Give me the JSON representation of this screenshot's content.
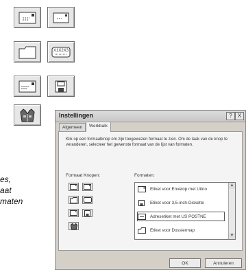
{
  "side_text": {
    "line1": "es,",
    "line2": "aat",
    "line3": "maten"
  },
  "toolbar_large": {
    "buttons": [
      {
        "icon": "envelope-icon"
      },
      {
        "icon": "envelope-small-icon"
      },
      {
        "icon": "folder-label-icon"
      },
      {
        "icon": "address-label-icon"
      },
      {
        "icon": "envelope-wide-icon"
      },
      {
        "icon": "floppy-label-icon"
      },
      {
        "icon": "vest-icon"
      }
    ]
  },
  "dialog": {
    "title": "Instellingen",
    "help_button": "?",
    "close_button": "X",
    "tabs": [
      {
        "label": "Algemeen",
        "active": false
      },
      {
        "label": "Werkbalk",
        "active": true
      }
    ],
    "description": "Klik op een formaatknop om zijn toegewezen formaat te zien. Om de taak van de knop te veranderen, selecteer het gewenste formaat van de lijst van formaten.",
    "format_buttons_label": "Formaat Knopen:",
    "formats_label": "Formaten:",
    "formats": [
      {
        "label": "Etiket voor Envelop met Uitno",
        "icon": "envelope-icon"
      },
      {
        "label": "Etiket voor 3,5-inch-Diskette",
        "icon": "floppy-label-icon"
      },
      {
        "label": "Adresetiket met US POSTNE",
        "icon": "address-label-icon",
        "selected": true
      },
      {
        "label": "Etiket voor Dossiermap",
        "icon": "folder-label-icon"
      }
    ],
    "ok_label": "OK",
    "cancel_label": "Annuleren"
  }
}
